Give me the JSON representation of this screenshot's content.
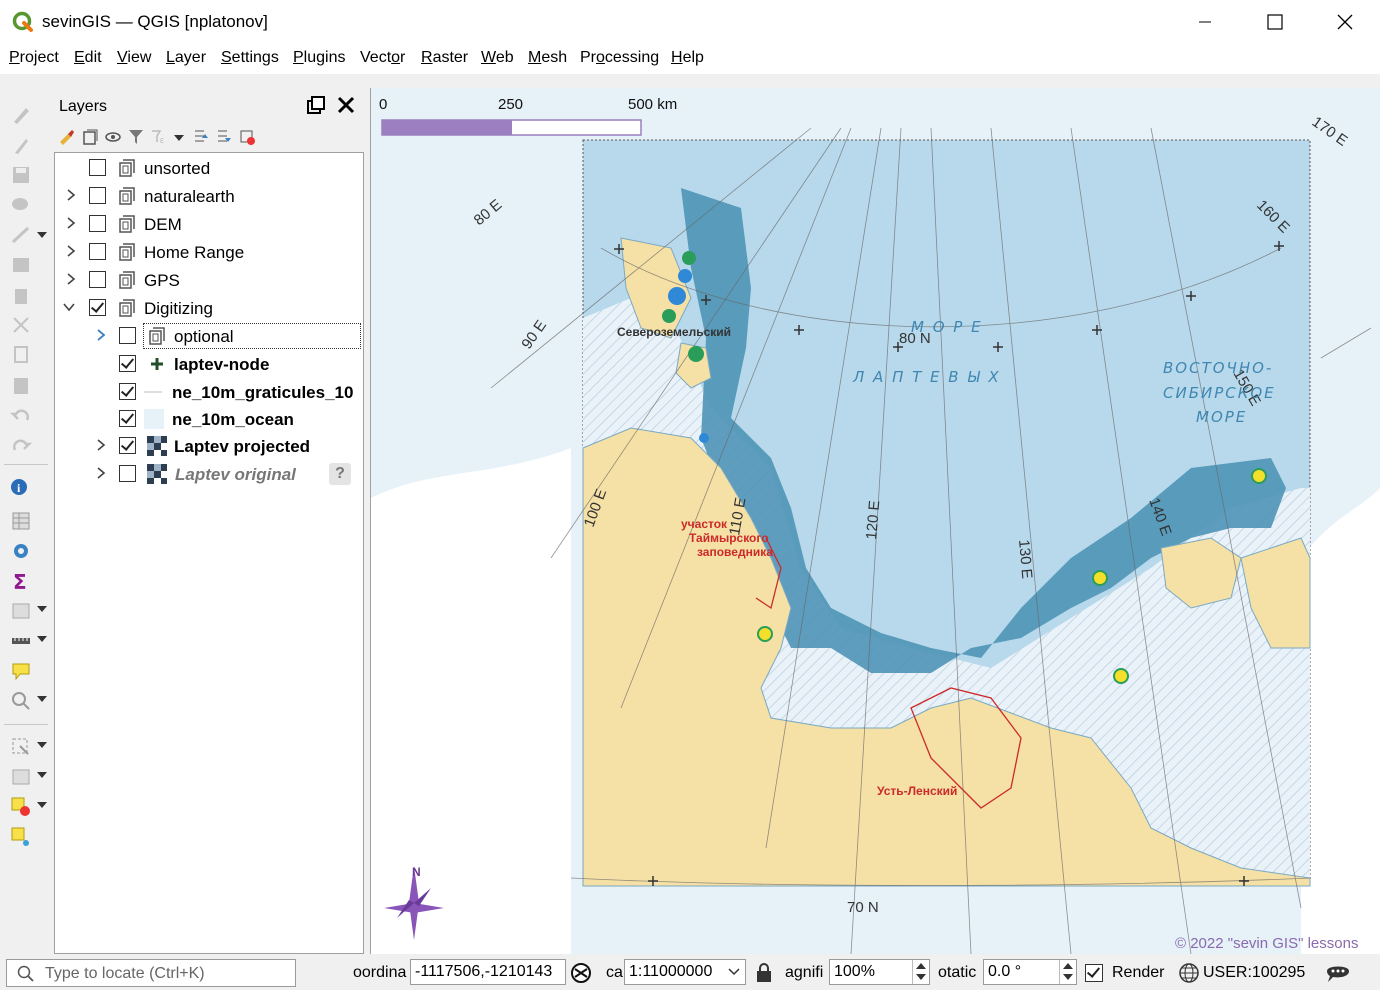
{
  "window": {
    "title": "sevinGIS — QGIS [nplatonov]",
    "controls": [
      "minimize",
      "maximize",
      "close"
    ]
  },
  "menu": [
    {
      "label": "Project",
      "accel": "P",
      "rest": "roject"
    },
    {
      "label": "Edit",
      "accel": "E",
      "rest": "dit"
    },
    {
      "label": "View",
      "accel": "V",
      "rest": "iew"
    },
    {
      "label": "Layer",
      "accel": "L",
      "rest": "ayer"
    },
    {
      "label": "Settings",
      "accel": "S",
      "rest": "ettings"
    },
    {
      "label": "Plugins",
      "accel": "P",
      "rest": "lugins"
    },
    {
      "label": "Vector",
      "accel": "o",
      "pre": "Vect",
      "rest": "r"
    },
    {
      "label": "Raster",
      "accel": "R",
      "rest": "aster"
    },
    {
      "label": "Web",
      "accel": "W",
      "rest": "eb"
    },
    {
      "label": "Mesh",
      "accel": "M",
      "rest": "esh"
    },
    {
      "label": "Processing",
      "accel": "o",
      "pre": "Pr",
      "rest": "cessing"
    },
    {
      "label": "Help",
      "accel": "H",
      "rest": "elp"
    }
  ],
  "layers_panel": {
    "title": "Layers",
    "toolbar_icons": [
      "style-manager-icon",
      "add-group-icon",
      "filter-visibility-icon",
      "filter-legend-icon",
      "expression-filter-icon",
      "expand-all-icon",
      "collapse-all-icon",
      "remove-layer-icon"
    ],
    "layers": [
      {
        "name": "unsorted",
        "checked": false,
        "indent": 0,
        "type": "group",
        "expander": "none",
        "style": "normal"
      },
      {
        "name": "naturalearth",
        "checked": false,
        "indent": 0,
        "type": "group",
        "expander": "collapsed",
        "style": "normal"
      },
      {
        "name": "DEM",
        "checked": false,
        "indent": 0,
        "type": "group",
        "expander": "collapsed",
        "style": "normal"
      },
      {
        "name": "Home Range",
        "checked": false,
        "indent": 0,
        "type": "group",
        "expander": "collapsed",
        "style": "normal"
      },
      {
        "name": "GPS",
        "checked": false,
        "indent": 0,
        "type": "group",
        "expander": "collapsed",
        "style": "normal"
      },
      {
        "name": "Digitizing",
        "checked": true,
        "indent": 0,
        "type": "group",
        "expander": "expanded",
        "style": "normal"
      },
      {
        "name": "optional",
        "checked": false,
        "indent": 1,
        "type": "group",
        "expander": "collapsed-blue",
        "style": "normal",
        "selected": true
      },
      {
        "name": "laptev-node",
        "checked": true,
        "indent": 1,
        "type": "point",
        "expander": "none",
        "style": "bold"
      },
      {
        "name": "ne_10m_graticules_10",
        "checked": true,
        "indent": 1,
        "type": "line",
        "expander": "none",
        "style": "bold"
      },
      {
        "name": "ne_10m_ocean",
        "checked": true,
        "indent": 1,
        "type": "polygon",
        "expander": "none",
        "style": "bold"
      },
      {
        "name": "Laptev projected",
        "checked": true,
        "indent": 1,
        "type": "raster",
        "expander": "collapsed",
        "style": "bold"
      },
      {
        "name": "Laptev original",
        "checked": false,
        "indent": 1,
        "type": "raster",
        "expander": "collapsed",
        "style": "italic",
        "warning": "?"
      }
    ]
  },
  "map": {
    "scalebar": {
      "labels": [
        "0",
        "250",
        "500 km"
      ],
      "color": "#9b7fc0"
    },
    "graticule_labels": [
      "80 E",
      "90 E",
      "100 E",
      "110 E",
      "120 E",
      "130 E",
      "140 E",
      "150 E",
      "160 E",
      "170 E",
      "80 N",
      "70 N"
    ],
    "sea_labels": [
      {
        "text": "М О Р Е"
      },
      {
        "text": "Л А П Т Е В Ы Х"
      },
      {
        "text": "ВОСТОЧНО-"
      },
      {
        "text": "СИБИРСКОЕ"
      },
      {
        "text": "МОРЕ"
      }
    ],
    "place_labels": [
      {
        "text": "Североземельский"
      },
      {
        "text": "участок"
      },
      {
        "text": "Таймырского"
      },
      {
        "text": "заповедника"
      },
      {
        "text": "Усть-Ленский"
      }
    ],
    "north_arrow_label": "N",
    "copyright": "© 2022 \"sevin GIS\" lessons",
    "colors": {
      "sea": "#b8d9ec",
      "sea_dark": "#4f93b6",
      "land": "#f5e0a5",
      "ocean_outside": "#e6f1f8",
      "hatch": "#c9d9e8"
    }
  },
  "statusbar": {
    "locator_placeholder": "Type to locate (Ctrl+K)",
    "coordinate_label": "oordina",
    "coordinate_value": "-1117506,-1210143",
    "scale_label": "ca",
    "scale_value": "1:11000000",
    "magnifier_label": "agnifi",
    "magnifier_value": "100%",
    "rotation_label": "otatic",
    "rotation_value": "0.0 °",
    "render_label": "Render",
    "render_checked": true,
    "crs_label": "USER:100295"
  }
}
